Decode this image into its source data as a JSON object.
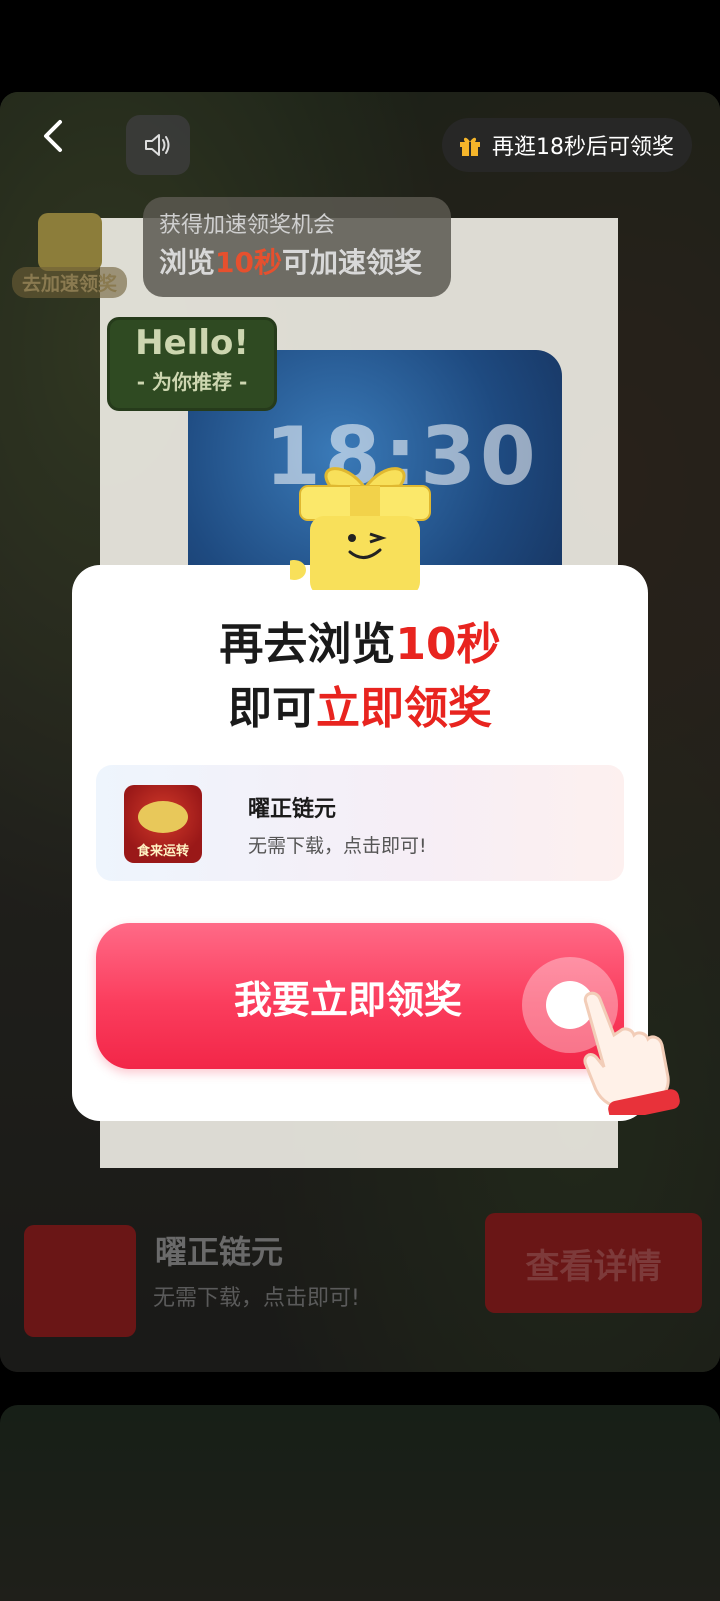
{
  "top_bar": {
    "timer_text": "再逛18秒后可领奖"
  },
  "speed_tip": {
    "line1": "获得加速领奖机会",
    "line2_prefix": "浏览",
    "line2_highlight": "10秒",
    "line2_suffix": "可加速领奖",
    "badge_label": "去加速领奖"
  },
  "hello_badge": {
    "title": "Hello!",
    "subtitle": "- 为你推荐 -"
  },
  "background_ad": {
    "phone_time": "18:30",
    "app_name": "曜正链元",
    "app_sub": "无需下载，点击即可!",
    "cta": "查看详情"
  },
  "modal": {
    "title_line1_prefix": "再去浏览",
    "title_line1_highlight": "10秒",
    "title_line2_prefix": "即可",
    "title_line2_highlight": "立即领奖",
    "app_name": "曜正链元",
    "app_sub": "无需下载，点击即可!",
    "app_icon_brand": "食来运转",
    "claim_button": "我要立即领奖"
  },
  "colors": {
    "accent_red": "#e8241f",
    "button_pink": "#fb3d5d",
    "mascot_yellow": "#f8e05a"
  },
  "icons": [
    "back-arrow-icon",
    "speaker-icon",
    "gift-icon",
    "gift-box-mascot-icon",
    "pointing-hand-icon"
  ]
}
